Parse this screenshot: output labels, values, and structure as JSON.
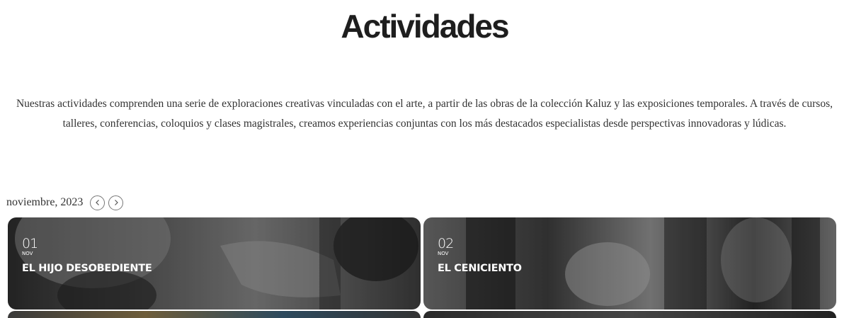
{
  "page": {
    "title": "Actividades",
    "intro": "Nuestras actividades comprenden una serie de exploraciones creativas vinculadas con el arte, a partir de las obras de la colección Kaluz y las exposiciones temporales. A través de cursos, talleres, conferencias, coloquios y clases magistrales, creamos experiencias conjuntas con los más destacados especialistas desde perspectivas innovadoras y lúdicas."
  },
  "calendar": {
    "month_label": "noviembre, 2023",
    "prev_icon": "chevron-left-icon",
    "next_icon": "chevron-right-icon"
  },
  "events": [
    {
      "day": "01",
      "month": "NOV",
      "title": "EL HIJO DESOBEDIENTE"
    },
    {
      "day": "02",
      "month": "NOV",
      "title": "EL CENICIENTO"
    }
  ],
  "colors": {
    "text": "#333333",
    "title": "#1e1e1e",
    "card_overlay": "#000000"
  }
}
